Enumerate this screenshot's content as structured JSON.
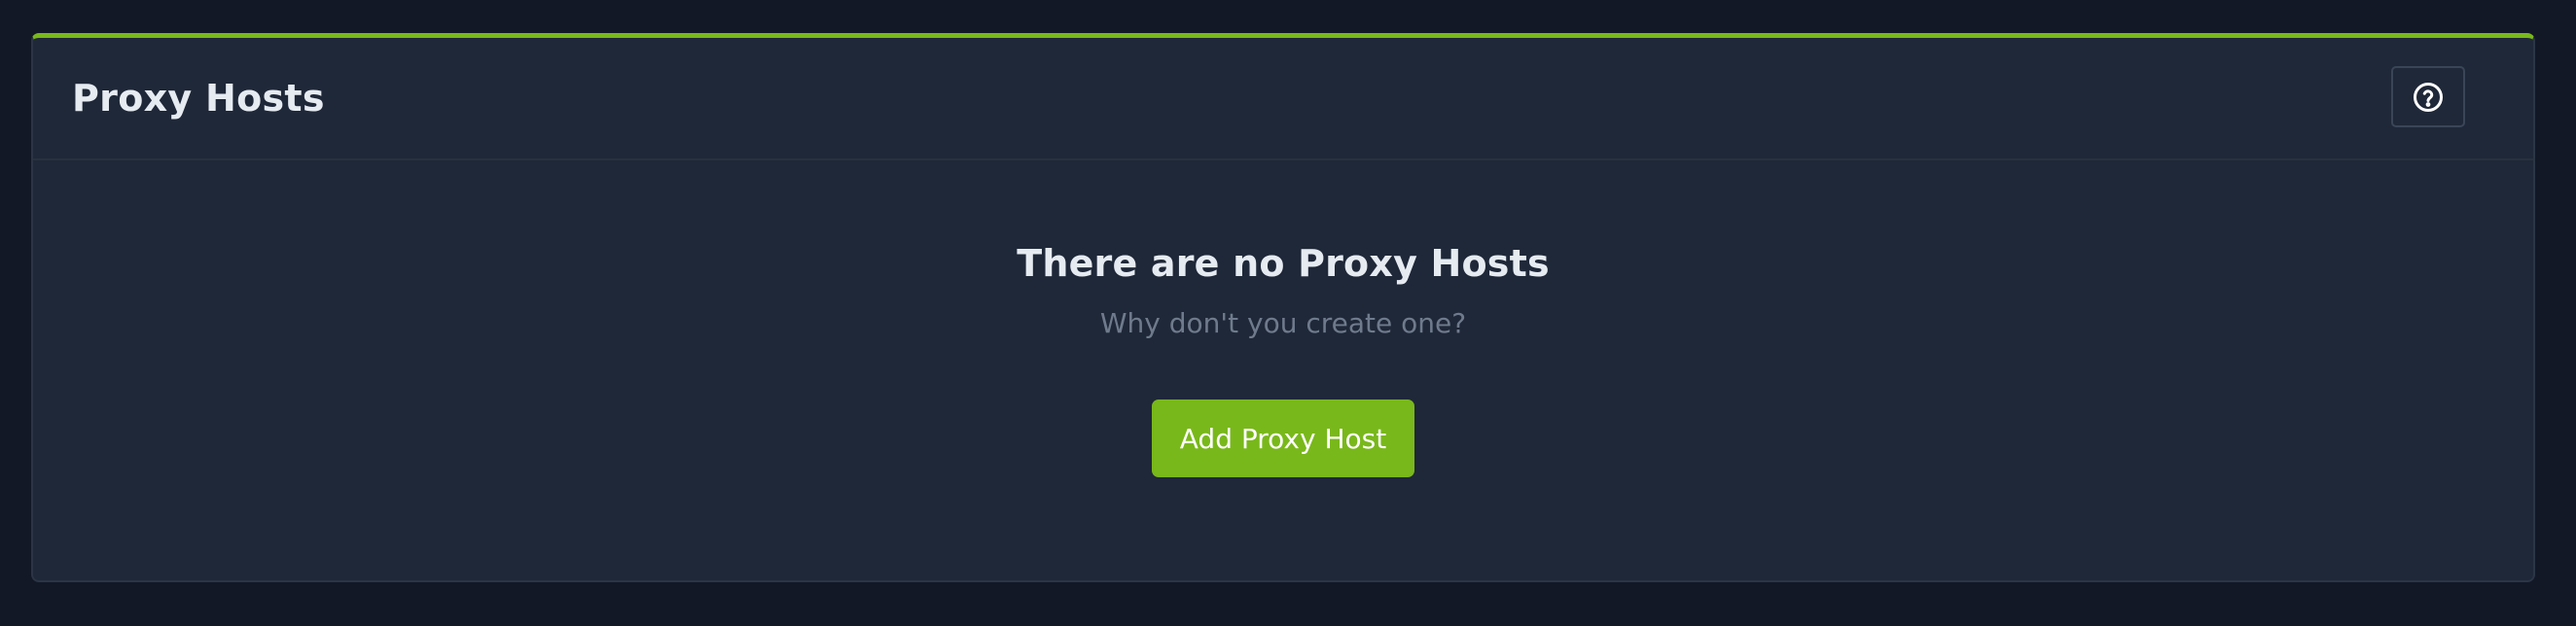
{
  "card": {
    "title": "Proxy Hosts",
    "help_icon": "question-circle-icon"
  },
  "empty_state": {
    "title": "There are no Proxy Hosts",
    "subtitle": "Why don't you create one?",
    "button_label": "Add Proxy Host"
  },
  "colors": {
    "background": "#121826",
    "card": "#1f2838",
    "accent": "#79b81b",
    "muted_text": "#6f7b8d",
    "primary_text": "#e6ebf2"
  }
}
